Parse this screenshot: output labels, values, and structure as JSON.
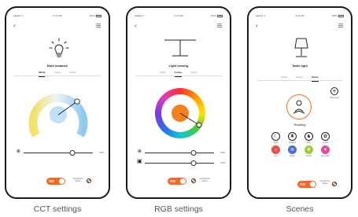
{
  "status_bar": {
    "signal": "●●●●● ᯤ",
    "time": "9:41 AM",
    "battery": "100%"
  },
  "cct_screen": {
    "device_name": "Bulb lostance",
    "tabs": [
      {
        "label": "White"
      },
      {
        "label": "Colour"
      },
      {
        "label": "Scene"
      }
    ],
    "active_tab": "White",
    "brightness_percent": 70,
    "power": "ON",
    "control_mode_label": "Conditioner Status"
  },
  "rgb_screen": {
    "device_name": "Light lensing",
    "tabs": [
      {
        "label": "White"
      },
      {
        "label": "Colour"
      },
      {
        "label": "Scene"
      }
    ],
    "active_tab": "Colour",
    "brightness_percent": 70,
    "saturation_percent": 70,
    "power": "ON",
    "control_mode_label": "Conditioner Status"
  },
  "scenes_screen": {
    "device_name": "Table light",
    "tabs": [
      {
        "label": "White"
      },
      {
        "label": "Colour"
      },
      {
        "label": "Scene"
      }
    ],
    "active_tab": "Scene",
    "add_label": "Add scene",
    "current_scene": "Reading",
    "scenes": [
      {
        "label": "Night",
        "icon": "moon-icon",
        "glyph": "☾",
        "filled": false,
        "color": "#ffffff"
      },
      {
        "label": "Reading",
        "icon": "reading-icon",
        "glyph": "♜",
        "filled": false,
        "color": "#ffffff"
      },
      {
        "label": "Work",
        "icon": "work-icon",
        "glyph": "♞",
        "filled": false,
        "color": "#ffffff"
      },
      {
        "label": "Leisure",
        "icon": "leisure-icon",
        "glyph": "✿",
        "filled": false,
        "color": "#ffffff"
      },
      {
        "label": "Fire",
        "icon": "home-icon",
        "glyph": "⌂",
        "filled": true,
        "color": "#e94e4e"
      },
      {
        "label": "Ocean",
        "icon": "waves-icon",
        "glyph": "≋",
        "filled": true,
        "color": "#4a6fd6"
      },
      {
        "label": "Forest",
        "icon": "leaf-icon",
        "glyph": "❦",
        "filled": true,
        "color": "#9bcc3c"
      },
      {
        "label": "Romantic",
        "icon": "heart-icon",
        "glyph": "♥",
        "filled": true,
        "color": "#e84a9e"
      }
    ],
    "power": "ON",
    "control_mode_label": "Conditioner Status"
  },
  "captions": {
    "cct": "CCT settings",
    "rgb": "RGB settings",
    "scenes": "Scenes"
  },
  "colors": {
    "accent": "#f26a21",
    "cct_dial_cool": "#8fc9ee",
    "cct_dial_warm": "#f3df6a",
    "dial_center_cct": "#bfe0f5"
  }
}
